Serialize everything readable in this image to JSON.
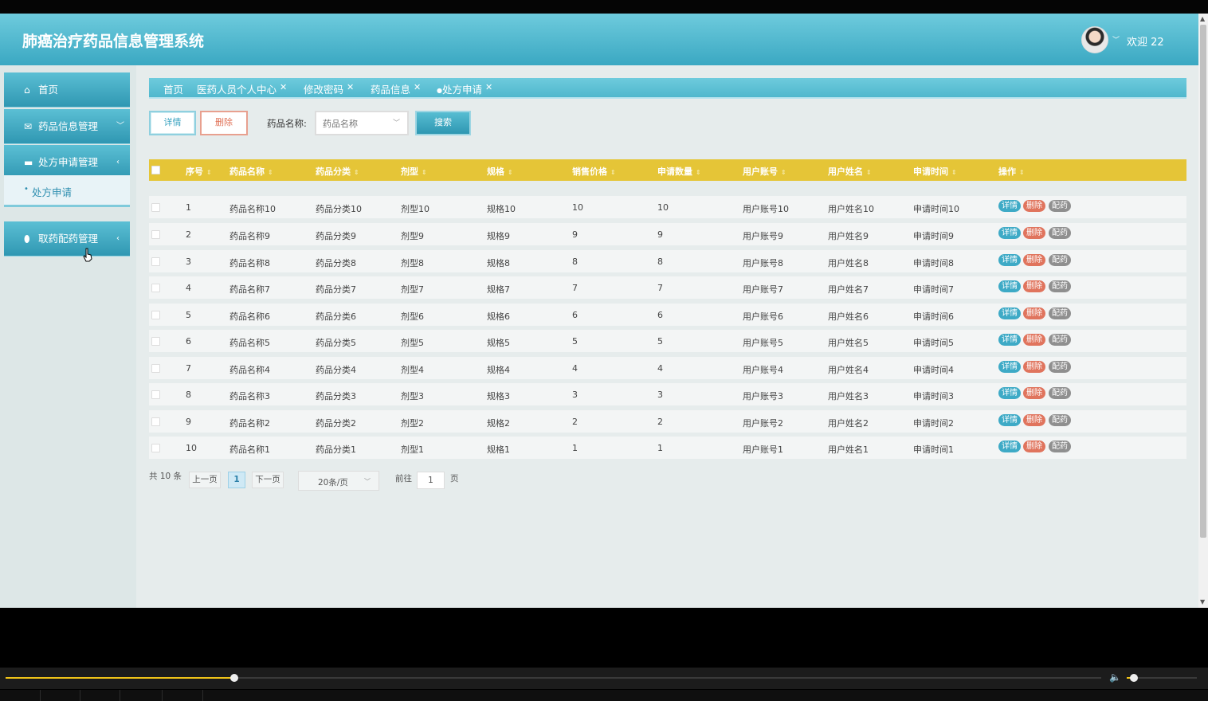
{
  "app": {
    "title": "肺癌治疗药品信息管理系统",
    "welcome": "欢迎 22"
  },
  "sidebar": {
    "items": [
      {
        "icon": "home-icon",
        "label": "首页"
      },
      {
        "icon": "mail-icon",
        "label": "药品信息管理"
      },
      {
        "icon": "ticket-icon",
        "label": "处方申请管理"
      },
      {
        "icon": "shield-icon",
        "label": "取药配药管理"
      }
    ],
    "sub_active": "处方申请"
  },
  "tabs": [
    "首页",
    "医药人员个人中心",
    "修改密码",
    "药品信息",
    "处方申请"
  ],
  "toolbar": {
    "detail_label": "详情",
    "delete_label": "删除",
    "search_label": "药品名称:",
    "search_placeholder": "药品名称",
    "search_button": "搜索"
  },
  "table": {
    "headers": [
      "序号",
      "药品名称",
      "药品分类",
      "剂型",
      "规格",
      "销售价格",
      "申请数量",
      "用户账号",
      "用户姓名",
      "申请时间",
      "操作"
    ],
    "rows": [
      [
        "1",
        "药品名称10",
        "药品分类10",
        "剂型10",
        "规格10",
        "10",
        "10",
        "用户账号10",
        "用户姓名10",
        "申请时间10"
      ],
      [
        "2",
        "药品名称9",
        "药品分类9",
        "剂型9",
        "规格9",
        "9",
        "9",
        "用户账号9",
        "用户姓名9",
        "申请时间9"
      ],
      [
        "3",
        "药品名称8",
        "药品分类8",
        "剂型8",
        "规格8",
        "8",
        "8",
        "用户账号8",
        "用户姓名8",
        "申请时间8"
      ],
      [
        "4",
        "药品名称7",
        "药品分类7",
        "剂型7",
        "规格7",
        "7",
        "7",
        "用户账号7",
        "用户姓名7",
        "申请时间7"
      ],
      [
        "5",
        "药品名称6",
        "药品分类6",
        "剂型6",
        "规格6",
        "6",
        "6",
        "用户账号6",
        "用户姓名6",
        "申请时间6"
      ],
      [
        "6",
        "药品名称5",
        "药品分类5",
        "剂型5",
        "规格5",
        "5",
        "5",
        "用户账号5",
        "用户姓名5",
        "申请时间5"
      ],
      [
        "7",
        "药品名称4",
        "药品分类4",
        "剂型4",
        "规格4",
        "4",
        "4",
        "用户账号4",
        "用户姓名4",
        "申请时间4"
      ],
      [
        "8",
        "药品名称3",
        "药品分类3",
        "剂型3",
        "规格3",
        "3",
        "3",
        "用户账号3",
        "用户姓名3",
        "申请时间3"
      ],
      [
        "9",
        "药品名称2",
        "药品分类2",
        "剂型2",
        "规格2",
        "2",
        "2",
        "用户账号2",
        "用户姓名2",
        "申请时间2"
      ],
      [
        "10",
        "药品名称1",
        "药品分类1",
        "剂型1",
        "规格1",
        "1",
        "1",
        "用户账号1",
        "用户姓名1",
        "申请时间1"
      ]
    ],
    "actions": [
      "详情",
      "删除",
      "配药"
    ]
  },
  "pagination": {
    "total": "共 10 条",
    "prev": "上一页",
    "current": "1",
    "next": "下一页",
    "page_size": "20条/页",
    "goto_label": "前往",
    "goto_value": "1",
    "page_unit": "页"
  },
  "player": {
    "progress": 0.2,
    "volume": 0.1
  },
  "colors": {
    "header": "#4fb7cd",
    "table_header": "#e5c537",
    "delete": "#e0745d",
    "accent": "#3aa3c0"
  }
}
